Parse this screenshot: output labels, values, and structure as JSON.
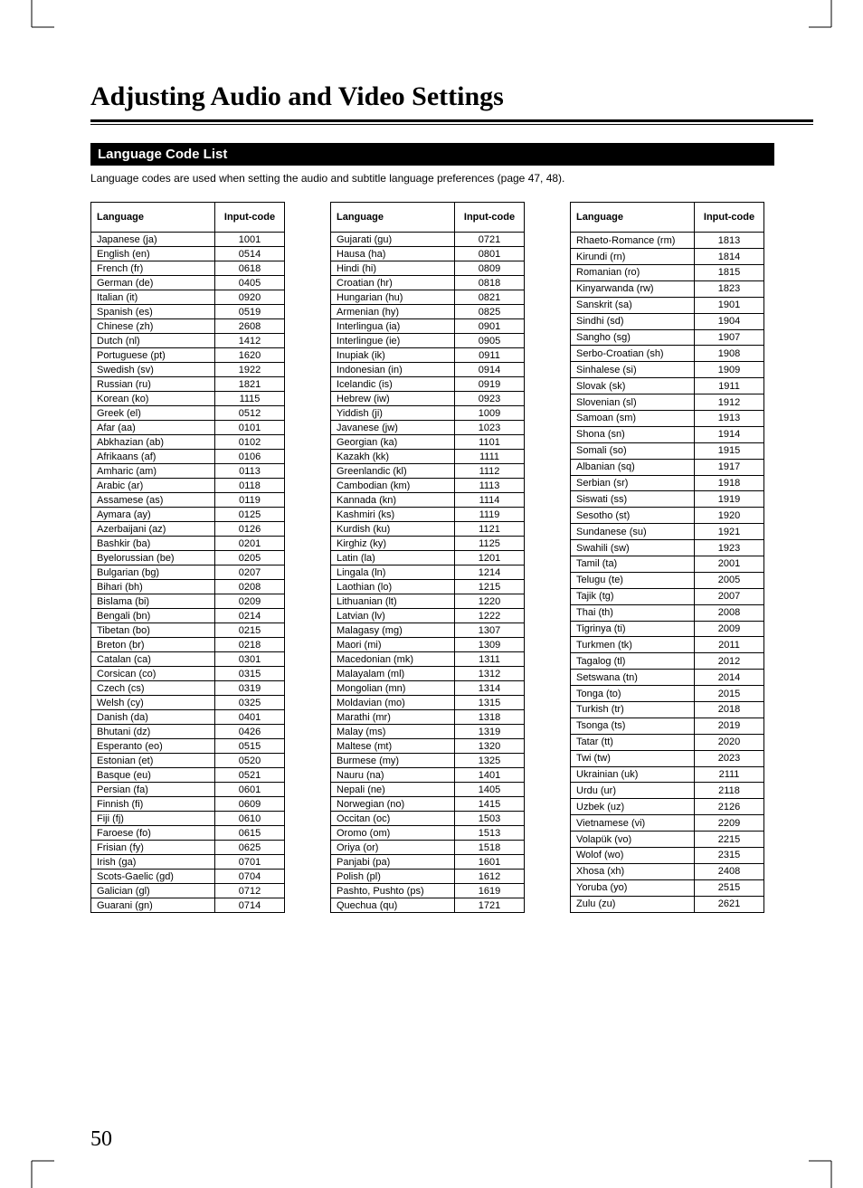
{
  "heading": "Adjusting Audio and Video Settings",
  "sectionTitle": "Language Code List",
  "intro": "Language codes are used when setting the audio and subtitle language preferences (page 47, 48).",
  "headers": {
    "lang": "Language",
    "code": "Input-code"
  },
  "pageNumber": "50",
  "tables": [
    [
      {
        "lang": "Japanese (ja)",
        "code": "1001"
      },
      {
        "lang": "English (en)",
        "code": "0514"
      },
      {
        "lang": "French (fr)",
        "code": "0618"
      },
      {
        "lang": "German (de)",
        "code": "0405"
      },
      {
        "lang": "Italian (it)",
        "code": "0920"
      },
      {
        "lang": "Spanish (es)",
        "code": "0519"
      },
      {
        "lang": "Chinese (zh)",
        "code": "2608"
      },
      {
        "lang": "Dutch (nl)",
        "code": "1412"
      },
      {
        "lang": "Portuguese (pt)",
        "code": "1620"
      },
      {
        "lang": "Swedish (sv)",
        "code": "1922"
      },
      {
        "lang": "Russian (ru)",
        "code": "1821"
      },
      {
        "lang": "Korean (ko)",
        "code": "1115"
      },
      {
        "lang": "Greek (el)",
        "code": "0512"
      },
      {
        "lang": "Afar (aa)",
        "code": "0101"
      },
      {
        "lang": "Abkhazian (ab)",
        "code": "0102"
      },
      {
        "lang": "Afrikaans (af)",
        "code": "0106"
      },
      {
        "lang": "Amharic (am)",
        "code": "0113"
      },
      {
        "lang": "Arabic (ar)",
        "code": "0118"
      },
      {
        "lang": "Assamese (as)",
        "code": "0119"
      },
      {
        "lang": "Aymara (ay)",
        "code": "0125"
      },
      {
        "lang": "Azerbaijani (az)",
        "code": "0126"
      },
      {
        "lang": "Bashkir (ba)",
        "code": "0201"
      },
      {
        "lang": "Byelorussian (be)",
        "code": "0205"
      },
      {
        "lang": "Bulgarian (bg)",
        "code": "0207"
      },
      {
        "lang": "Bihari (bh)",
        "code": "0208"
      },
      {
        "lang": "Bislama (bi)",
        "code": "0209"
      },
      {
        "lang": "Bengali (bn)",
        "code": "0214"
      },
      {
        "lang": "Tibetan (bo)",
        "code": "0215"
      },
      {
        "lang": "Breton (br)",
        "code": "0218"
      },
      {
        "lang": "Catalan (ca)",
        "code": "0301"
      },
      {
        "lang": "Corsican (co)",
        "code": "0315"
      },
      {
        "lang": "Czech (cs)",
        "code": "0319"
      },
      {
        "lang": "Welsh (cy)",
        "code": "0325"
      },
      {
        "lang": "Danish (da)",
        "code": "0401"
      },
      {
        "lang": "Bhutani (dz)",
        "code": "0426"
      },
      {
        "lang": "Esperanto (eo)",
        "code": "0515"
      },
      {
        "lang": "Estonian (et)",
        "code": "0520"
      },
      {
        "lang": "Basque (eu)",
        "code": "0521"
      },
      {
        "lang": "Persian (fa)",
        "code": "0601"
      },
      {
        "lang": "Finnish (fi)",
        "code": "0609"
      },
      {
        "lang": "Fiji (fj)",
        "code": "0610"
      },
      {
        "lang": "Faroese (fo)",
        "code": "0615"
      },
      {
        "lang": "Frisian (fy)",
        "code": "0625"
      },
      {
        "lang": "Irish (ga)",
        "code": "0701"
      },
      {
        "lang": "Scots-Gaelic (gd)",
        "code": "0704"
      },
      {
        "lang": "Galician (gl)",
        "code": "0712"
      },
      {
        "lang": "Guarani (gn)",
        "code": "0714"
      }
    ],
    [
      {
        "lang": "Gujarati (gu)",
        "code": "0721"
      },
      {
        "lang": "Hausa (ha)",
        "code": "0801"
      },
      {
        "lang": "Hindi (hi)",
        "code": "0809"
      },
      {
        "lang": "Croatian (hr)",
        "code": "0818"
      },
      {
        "lang": "Hungarian (hu)",
        "code": "0821"
      },
      {
        "lang": "Armenian (hy)",
        "code": "0825"
      },
      {
        "lang": "Interlingua (ia)",
        "code": "0901"
      },
      {
        "lang": "Interlingue (ie)",
        "code": "0905"
      },
      {
        "lang": "Inupiak (ik)",
        "code": "0911"
      },
      {
        "lang": "Indonesian (in)",
        "code": "0914"
      },
      {
        "lang": "Icelandic (is)",
        "code": "0919"
      },
      {
        "lang": "Hebrew (iw)",
        "code": "0923"
      },
      {
        "lang": "Yiddish (ji)",
        "code": "1009"
      },
      {
        "lang": "Javanese (jw)",
        "code": "1023"
      },
      {
        "lang": "Georgian (ka)",
        "code": "1101"
      },
      {
        "lang": "Kazakh (kk)",
        "code": "1111"
      },
      {
        "lang": "Greenlandic (kl)",
        "code": "1112"
      },
      {
        "lang": "Cambodian (km)",
        "code": "1113"
      },
      {
        "lang": "Kannada (kn)",
        "code": "1114"
      },
      {
        "lang": "Kashmiri (ks)",
        "code": "1119"
      },
      {
        "lang": "Kurdish (ku)",
        "code": "1121"
      },
      {
        "lang": "Kirghiz (ky)",
        "code": "1125"
      },
      {
        "lang": "Latin (la)",
        "code": "1201"
      },
      {
        "lang": "Lingala (ln)",
        "code": "1214"
      },
      {
        "lang": "Laothian (lo)",
        "code": "1215"
      },
      {
        "lang": "Lithuanian (lt)",
        "code": "1220"
      },
      {
        "lang": "Latvian (lv)",
        "code": "1222"
      },
      {
        "lang": "Malagasy (mg)",
        "code": "1307"
      },
      {
        "lang": "Maori (mi)",
        "code": "1309"
      },
      {
        "lang": "Macedonian (mk)",
        "code": "1311"
      },
      {
        "lang": "Malayalam (ml)",
        "code": "1312"
      },
      {
        "lang": "Mongolian (mn)",
        "code": "1314"
      },
      {
        "lang": "Moldavian (mo)",
        "code": "1315"
      },
      {
        "lang": "Marathi (mr)",
        "code": "1318"
      },
      {
        "lang": "Malay (ms)",
        "code": "1319"
      },
      {
        "lang": "Maltese (mt)",
        "code": "1320"
      },
      {
        "lang": "Burmese (my)",
        "code": "1325"
      },
      {
        "lang": "Nauru (na)",
        "code": "1401"
      },
      {
        "lang": "Nepali (ne)",
        "code": "1405"
      },
      {
        "lang": "Norwegian (no)",
        "code": "1415"
      },
      {
        "lang": "Occitan (oc)",
        "code": "1503"
      },
      {
        "lang": "Oromo (om)",
        "code": "1513"
      },
      {
        "lang": "Oriya (or)",
        "code": "1518"
      },
      {
        "lang": "Panjabi (pa)",
        "code": "1601"
      },
      {
        "lang": "Polish (pl)",
        "code": "1612"
      },
      {
        "lang": "Pashto, Pushto (ps)",
        "code": "1619"
      },
      {
        "lang": "Quechua (qu)",
        "code": "1721"
      }
    ],
    [
      {
        "lang": "Rhaeto-Romance (rm)",
        "code": "1813"
      },
      {
        "lang": "Kirundi (rn)",
        "code": "1814"
      },
      {
        "lang": "Romanian (ro)",
        "code": "1815"
      },
      {
        "lang": "Kinyarwanda (rw)",
        "code": "1823"
      },
      {
        "lang": "Sanskrit (sa)",
        "code": "1901"
      },
      {
        "lang": "Sindhi (sd)",
        "code": "1904"
      },
      {
        "lang": "Sangho (sg)",
        "code": "1907"
      },
      {
        "lang": "Serbo-Croatian (sh)",
        "code": "1908"
      },
      {
        "lang": "Sinhalese (si)",
        "code": "1909"
      },
      {
        "lang": "Slovak (sk)",
        "code": "1911"
      },
      {
        "lang": "Slovenian (sl)",
        "code": "1912"
      },
      {
        "lang": "Samoan (sm)",
        "code": "1913"
      },
      {
        "lang": "Shona (sn)",
        "code": "1914"
      },
      {
        "lang": "Somali (so)",
        "code": "1915"
      },
      {
        "lang": "Albanian (sq)",
        "code": "1917"
      },
      {
        "lang": "Serbian (sr)",
        "code": "1918"
      },
      {
        "lang": "Siswati (ss)",
        "code": "1919"
      },
      {
        "lang": "Sesotho (st)",
        "code": "1920"
      },
      {
        "lang": "Sundanese (su)",
        "code": "1921"
      },
      {
        "lang": "Swahili (sw)",
        "code": "1923"
      },
      {
        "lang": "Tamil (ta)",
        "code": "2001"
      },
      {
        "lang": "Telugu (te)",
        "code": "2005"
      },
      {
        "lang": "Tajik (tg)",
        "code": "2007"
      },
      {
        "lang": "Thai (th)",
        "code": "2008"
      },
      {
        "lang": "Tigrinya (ti)",
        "code": "2009"
      },
      {
        "lang": "Turkmen (tk)",
        "code": "2011"
      },
      {
        "lang": "Tagalog (tl)",
        "code": "2012"
      },
      {
        "lang": "Setswana (tn)",
        "code": "2014"
      },
      {
        "lang": "Tonga (to)",
        "code": "2015"
      },
      {
        "lang": "Turkish (tr)",
        "code": "2018"
      },
      {
        "lang": "Tsonga (ts)",
        "code": "2019"
      },
      {
        "lang": "Tatar (tt)",
        "code": "2020"
      },
      {
        "lang": "Twi (tw)",
        "code": "2023"
      },
      {
        "lang": "Ukrainian (uk)",
        "code": "2111"
      },
      {
        "lang": "Urdu (ur)",
        "code": "2118"
      },
      {
        "lang": "Uzbek (uz)",
        "code": "2126"
      },
      {
        "lang": "Vietnamese (vi)",
        "code": "2209"
      },
      {
        "lang": "Volapük (vo)",
        "code": "2215"
      },
      {
        "lang": "Wolof (wo)",
        "code": "2315"
      },
      {
        "lang": "Xhosa (xh)",
        "code": "2408"
      },
      {
        "lang": "Yoruba (yo)",
        "code": "2515"
      },
      {
        "lang": "Zulu (zu)",
        "code": "2621"
      }
    ]
  ]
}
